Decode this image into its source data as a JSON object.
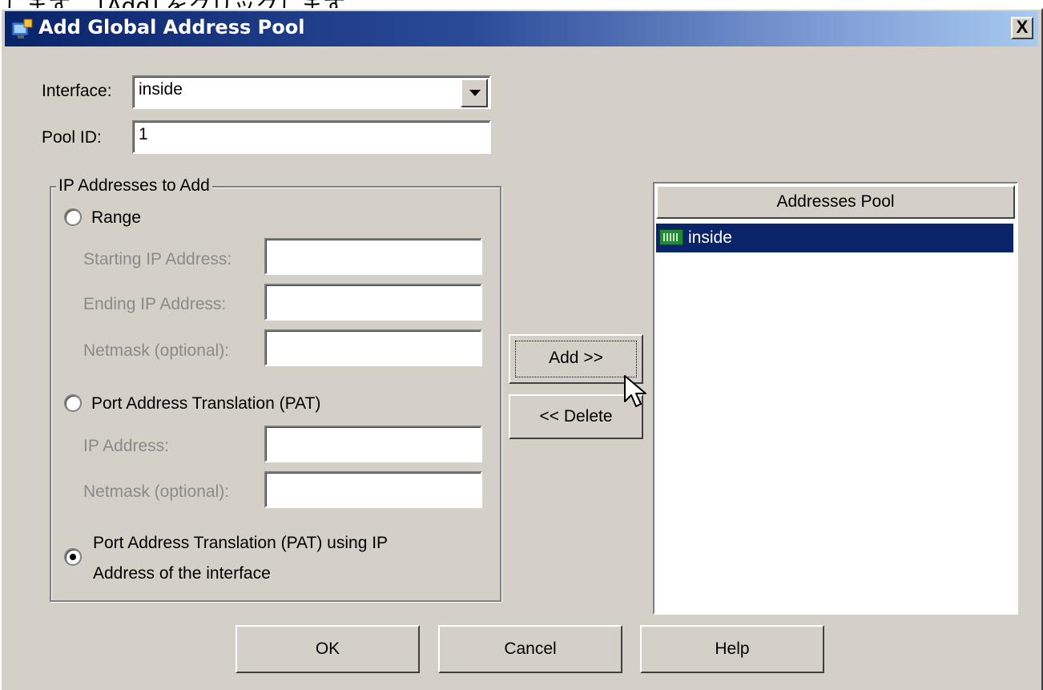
{
  "page_caption": "します。 [Add] をクリックします。",
  "dialog": {
    "title": "Add Global Address Pool",
    "close_label": "X"
  },
  "interface": {
    "label": "Interface:",
    "value": "inside"
  },
  "pool_id": {
    "label": "Pool ID:",
    "value": "1"
  },
  "ip_group": {
    "legend": "IP Addresses to Add",
    "range": {
      "label": "Range",
      "selected": false,
      "starting_ip_label": "Starting IP Address:",
      "ending_ip_label": "Ending  IP Address:",
      "netmask_label": "Netmask (optional):"
    },
    "pat": {
      "label": "Port Address Translation (PAT)",
      "selected": false,
      "ip_label": "IP Address:",
      "netmask_label": "Netmask (optional):"
    },
    "pat_interface": {
      "label_line1": "Port Address Translation (PAT) using IP",
      "label_line2": "Address of the interface",
      "selected": true
    }
  },
  "buttons": {
    "add": "Add >>",
    "delete": "<< Delete",
    "ok": "OK",
    "cancel": "Cancel",
    "help": "Help"
  },
  "address_pool": {
    "header": "Addresses Pool",
    "items": [
      {
        "icon": "interface-icon",
        "label": "inside",
        "selected": true
      }
    ]
  },
  "colors": {
    "dialog_bg": "#d4d0c8",
    "title_gradient_start": "#0a246a",
    "title_gradient_end": "#a6caf0",
    "selection_bg": "#0a246a"
  }
}
